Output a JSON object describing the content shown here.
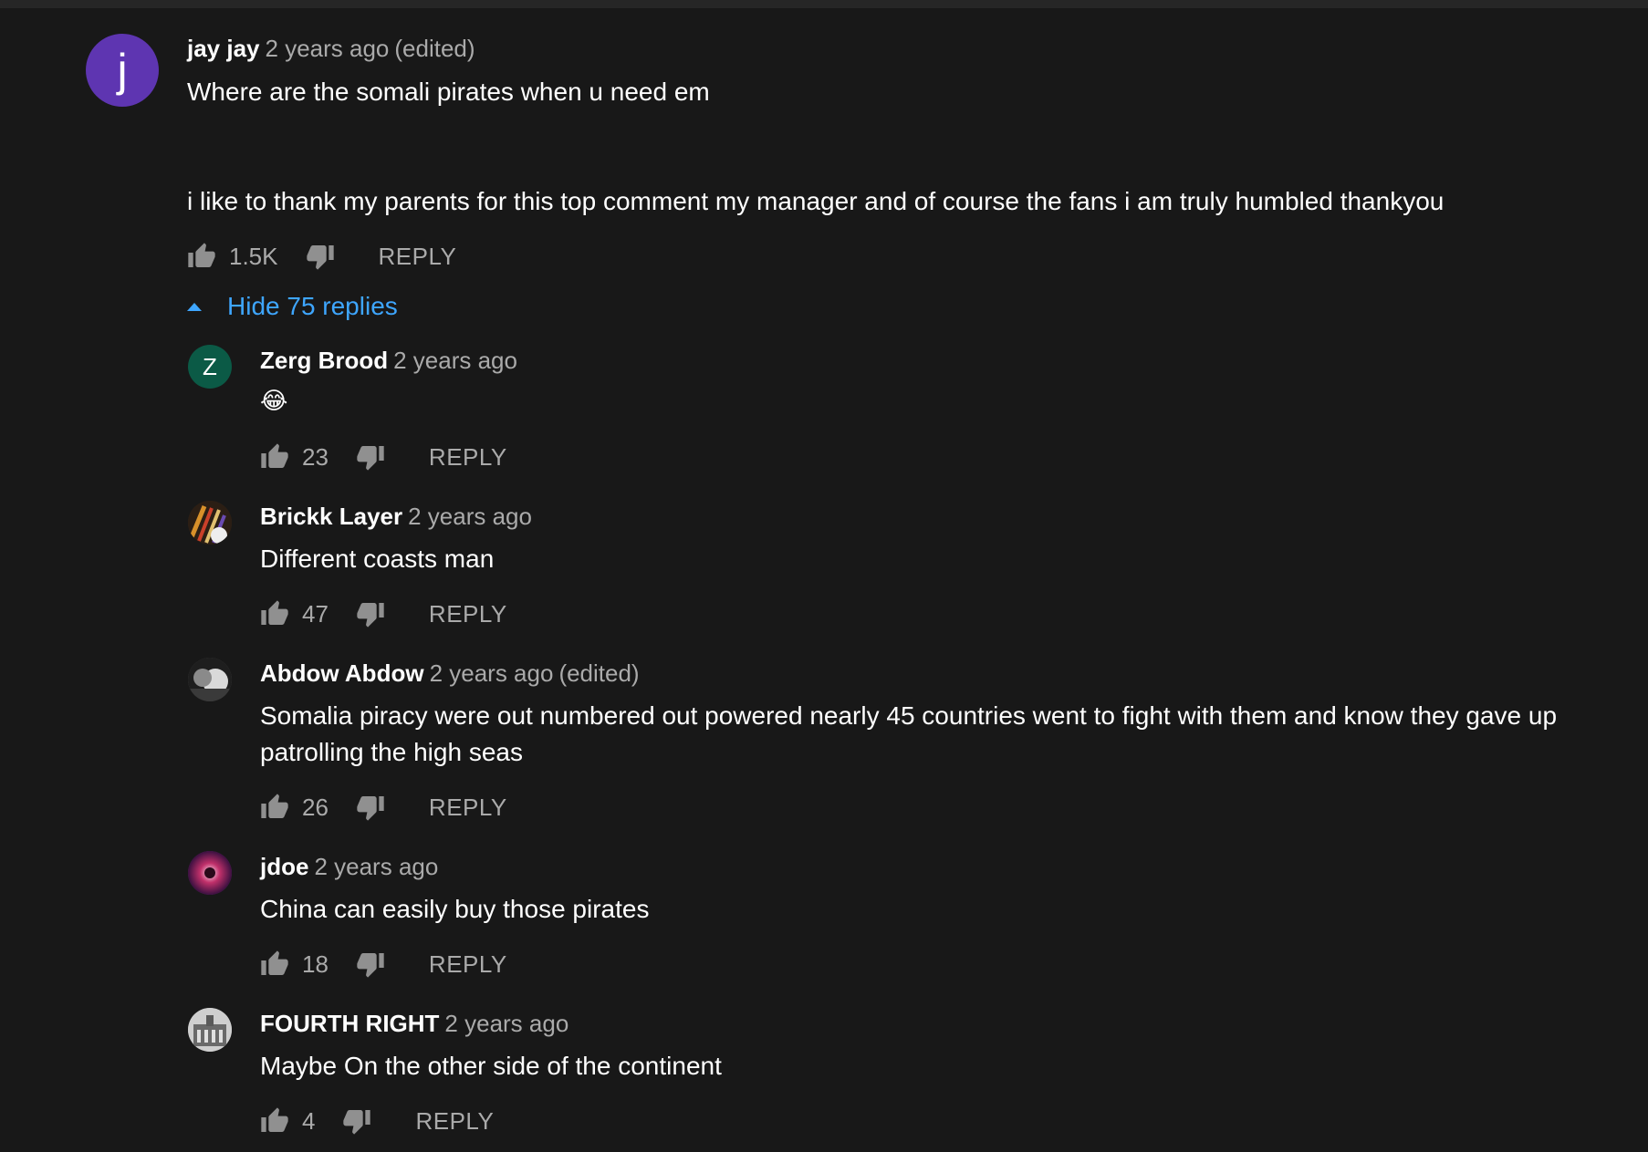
{
  "top_comment": {
    "avatar_letter": "j",
    "avatar_color": "#5e35b1",
    "author": "jay jay",
    "time": "2 years ago",
    "edited": "(edited)",
    "text_line1": "Where are the somali pirates when u need em",
    "text_line2": "i like to thank my parents for this top comment my manager and of course the fans i am truly humbled thankyou",
    "likes": "1.5K",
    "reply_label": "REPLY"
  },
  "replies_toggle": {
    "label": "Hide 75 replies"
  },
  "replies": [
    {
      "author": "Zerg Brood",
      "time": "2 years ago",
      "edited": "",
      "avatar_letter": "Z",
      "avatar_color": "#0b5a46",
      "text": "😂",
      "likes": "23",
      "reply_label": "REPLY"
    },
    {
      "author": "Brickk Layer",
      "time": "2 years ago",
      "edited": "",
      "text": "Different coasts man",
      "likes": "47",
      "reply_label": "REPLY"
    },
    {
      "author": "Abdow Abdow",
      "time": "2 years ago",
      "edited": "(edited)",
      "text": "Somalia piracy were out numbered out powered nearly 45 countries went to fight with them and know they gave up patrolling the high seas",
      "likes": "26",
      "reply_label": "REPLY"
    },
    {
      "author": "jdoe",
      "time": "2 years ago",
      "edited": "",
      "text": "China can easily buy those pirates",
      "likes": "18",
      "reply_label": "REPLY"
    },
    {
      "author": "FOURTH RIGHT",
      "time": "2 years ago",
      "edited": "",
      "text": "Maybe On the other side of the continent",
      "likes": "4",
      "reply_label": "REPLY"
    }
  ],
  "icons": {
    "like": "thumbs-up-icon",
    "dislike": "thumbs-down-icon",
    "caret": "caret-up-icon"
  },
  "colors": {
    "background": "#181818",
    "link": "#3ea6ff",
    "secondary_text": "#aaaaaa"
  }
}
